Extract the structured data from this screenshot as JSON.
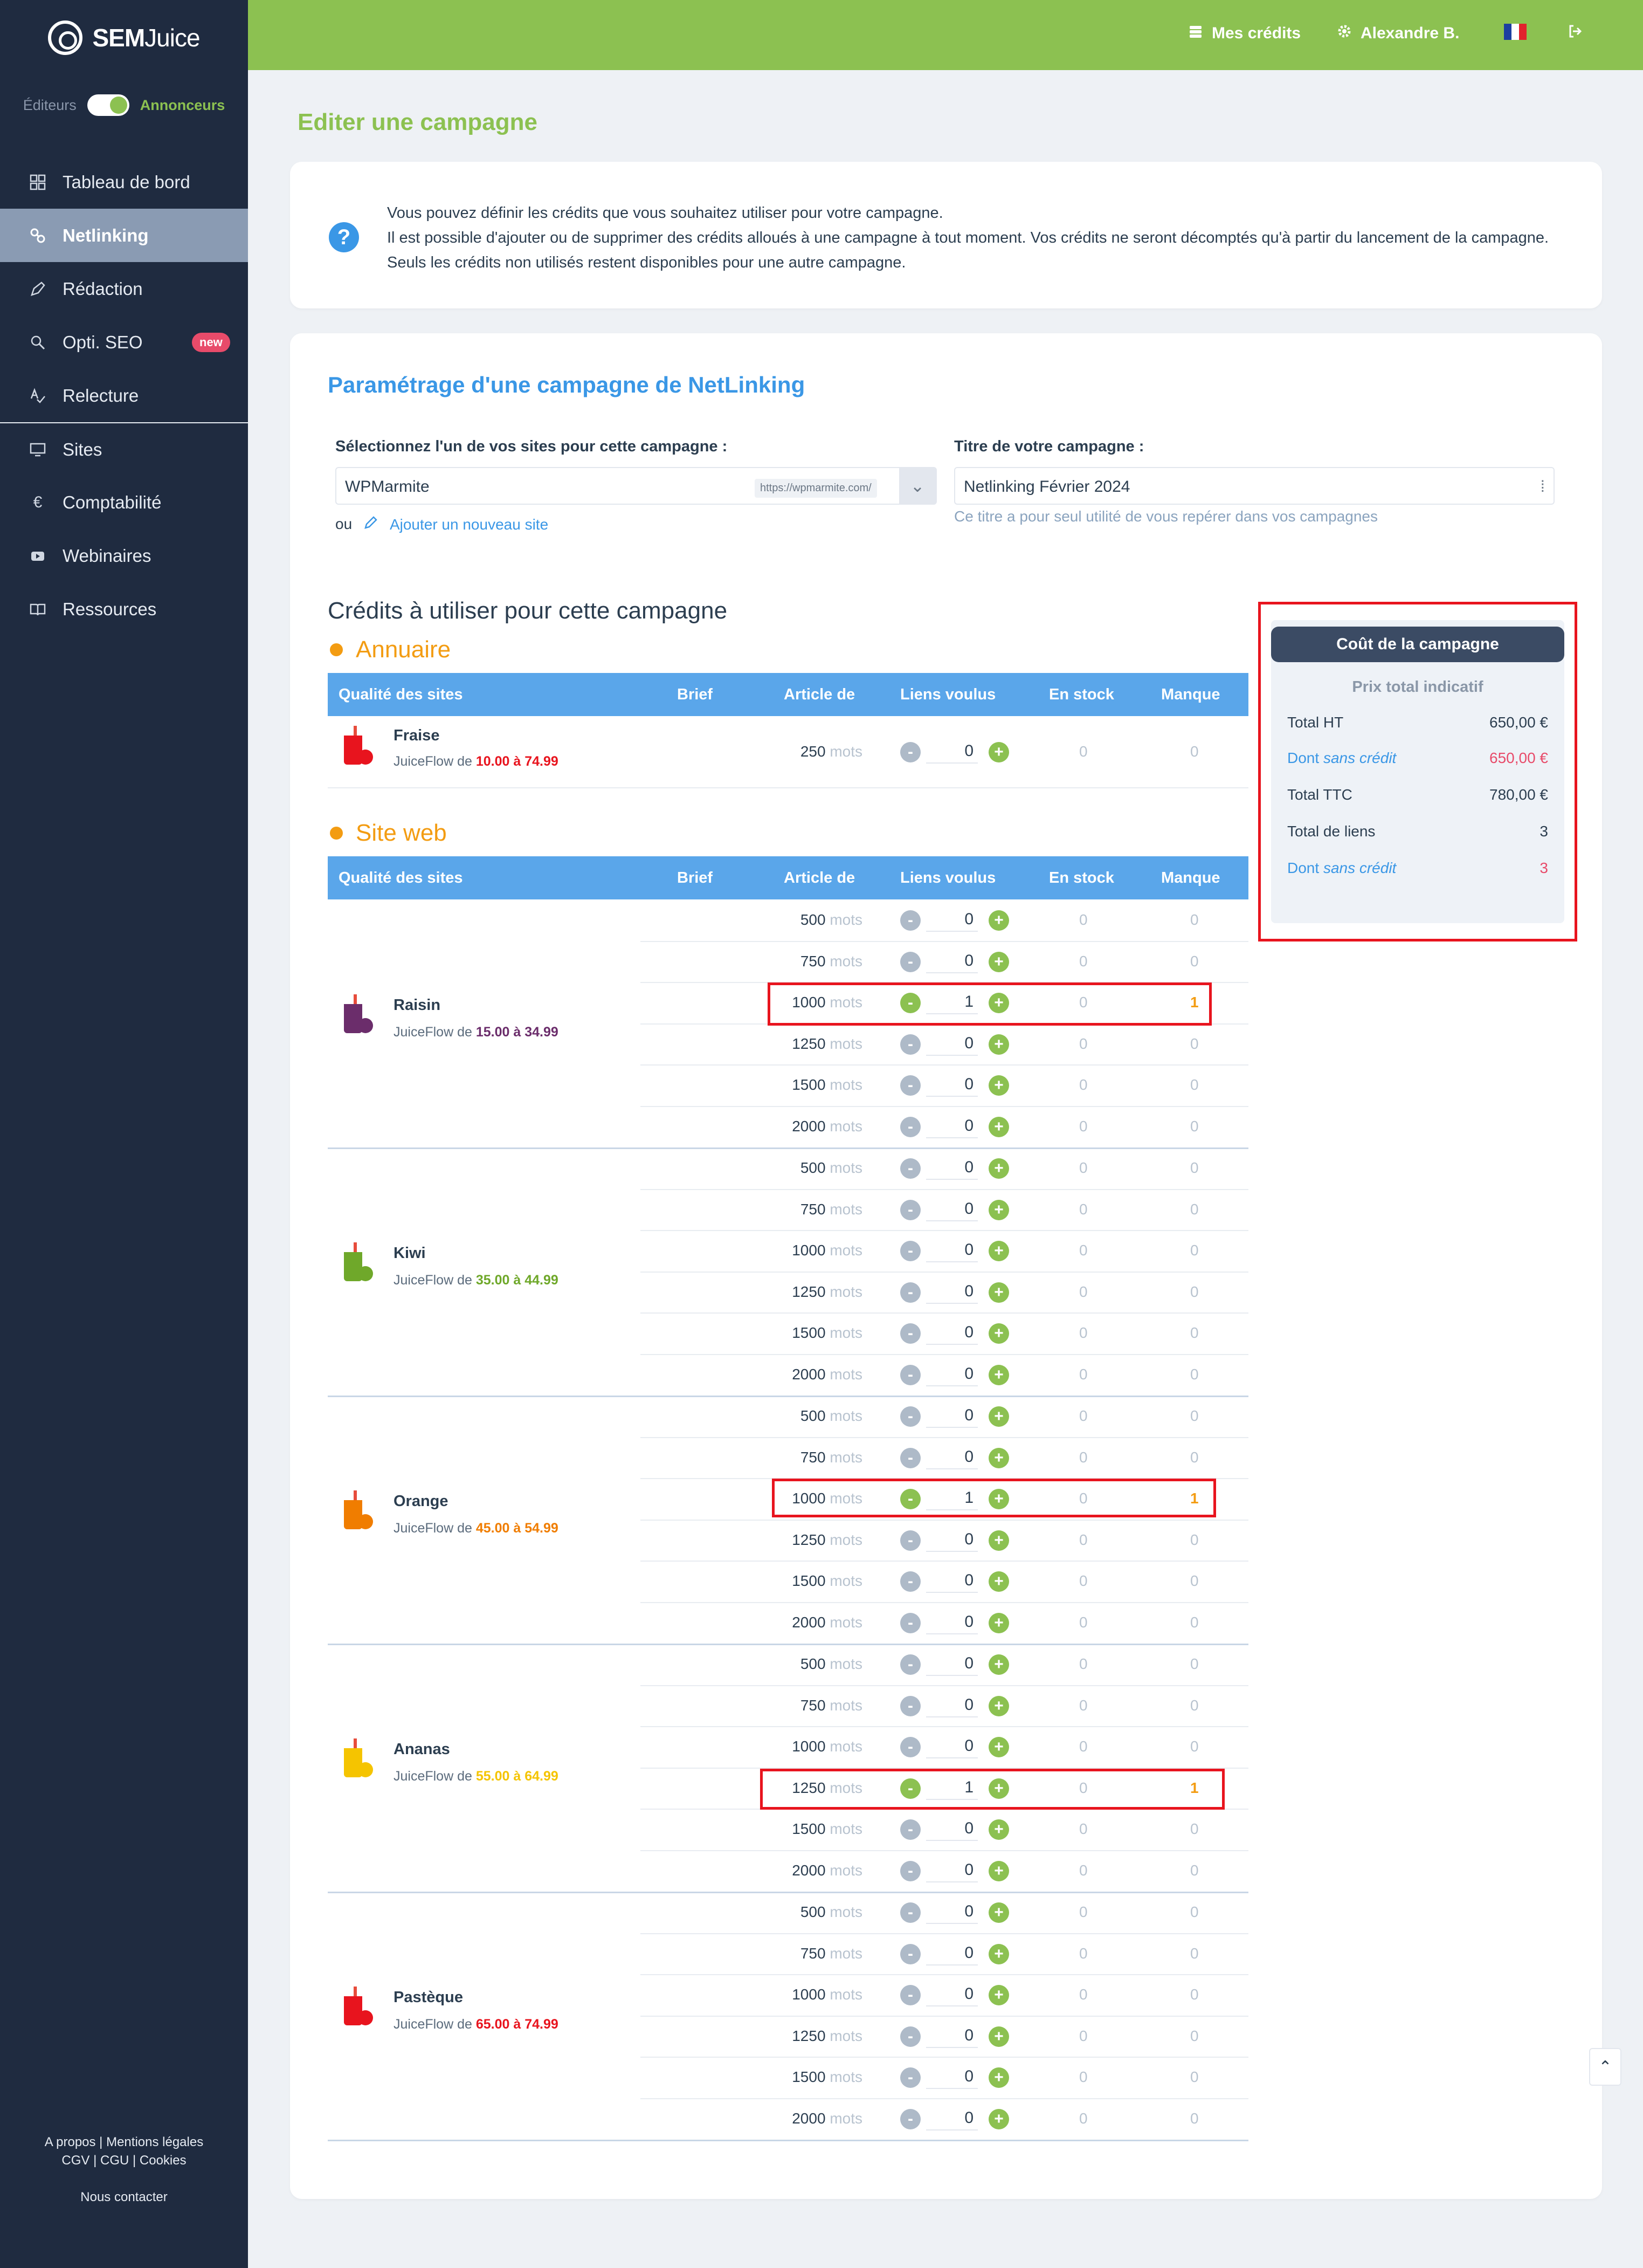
{
  "app": {
    "logo_bold": "SEM",
    "logo_light": "Juice",
    "switch_left": "Éditeurs",
    "switch_right": "Annonceurs"
  },
  "sidebar": {
    "items": [
      {
        "label": "Tableau de bord",
        "icon": "grid-icon"
      },
      {
        "label": "Netlinking",
        "icon": "link-icon"
      },
      {
        "label": "Rédaction",
        "icon": "pen-icon"
      },
      {
        "label": "Opti. SEO",
        "icon": "search-icon",
        "badge": "new"
      },
      {
        "label": "Relecture",
        "icon": "spellcheck-icon"
      },
      {
        "label": "Sites",
        "icon": "monitor-icon"
      },
      {
        "label": "Comptabilité",
        "icon": "euro-icon"
      },
      {
        "label": "Webinaires",
        "icon": "play-icon"
      },
      {
        "label": "Ressources",
        "icon": "book-icon"
      }
    ],
    "footer_line1": "A propos | Mentions légales",
    "footer_line2": "CGV | CGU | Cookies",
    "contact": "Nous contacter"
  },
  "topbar": {
    "credits": "Mes crédits",
    "user": "Alexandre B.",
    "language": "FR"
  },
  "page": {
    "title": "Editer une campagne",
    "help_line1": "Vous pouvez définir les crédits que vous souhaitez utiliser pour votre campagne.",
    "help_line2": "Il est possible d'ajouter ou de supprimer des crédits alloués à une campagne à tout moment. Vos crédits ne seront décomptés qu'à partir du lancement de la campagne. Seuls les crédits non utilisés restent disponibles pour une autre campagne."
  },
  "form": {
    "section_title": "Paramétrage d'une campagne de NetLinking",
    "site_label": "Sélectionnez l'un de vos sites pour cette campagne :",
    "site_value": "WPMarmite",
    "site_url": "https://wpmarmite.com/",
    "or": "ou",
    "add_site": "Ajouter un nouveau site",
    "title_label": "Titre de votre campagne :",
    "title_value": "Netlinking Février 2024",
    "title_hint": "Ce titre a pour seul utilité de vous repérer dans vos campagnes"
  },
  "credits": {
    "title": "Crédits à utiliser pour cette campagne",
    "columns": [
      "Qualité des sites",
      "Brief",
      "Article de",
      "Liens voulus",
      "En stock",
      "Manque"
    ],
    "unit": "mots",
    "annuaire_title": "Annuaire",
    "siteweb_title": "Site web",
    "annuaire": {
      "name": "Fraise",
      "price_prefix": "JuiceFlow de",
      "price_range": "10.00 à 74.99",
      "color": "#e8141e",
      "size": "250",
      "qty": "0",
      "stock": "0",
      "missing": "0"
    },
    "sites": [
      {
        "name": "Raisin",
        "price_prefix": "JuiceFlow de",
        "price_range": "15.00 à 34.99",
        "color": "#6b2d6b",
        "rows": [
          {
            "size": "500",
            "qty": "0",
            "stock": "0",
            "missing": "0"
          },
          {
            "size": "750",
            "qty": "0",
            "stock": "0",
            "missing": "0"
          },
          {
            "size": "1000",
            "qty": "1",
            "stock": "0",
            "missing": "1"
          },
          {
            "size": "1250",
            "qty": "0",
            "stock": "0",
            "missing": "0"
          },
          {
            "size": "1500",
            "qty": "0",
            "stock": "0",
            "missing": "0"
          },
          {
            "size": "2000",
            "qty": "0",
            "stock": "0",
            "missing": "0"
          }
        ]
      },
      {
        "name": "Kiwi",
        "price_prefix": "JuiceFlow de",
        "price_range": "35.00 à 44.99",
        "color": "#6fa82a",
        "rows": [
          {
            "size": "500",
            "qty": "0",
            "stock": "0",
            "missing": "0"
          },
          {
            "size": "750",
            "qty": "0",
            "stock": "0",
            "missing": "0"
          },
          {
            "size": "1000",
            "qty": "0",
            "stock": "0",
            "missing": "0"
          },
          {
            "size": "1250",
            "qty": "0",
            "stock": "0",
            "missing": "0"
          },
          {
            "size": "1500",
            "qty": "0",
            "stock": "0",
            "missing": "0"
          },
          {
            "size": "2000",
            "qty": "0",
            "stock": "0",
            "missing": "0"
          }
        ]
      },
      {
        "name": "Orange",
        "price_prefix": "JuiceFlow de",
        "price_range": "45.00 à 54.99",
        "color": "#f07d00",
        "rows": [
          {
            "size": "500",
            "qty": "0",
            "stock": "0",
            "missing": "0"
          },
          {
            "size": "750",
            "qty": "0",
            "stock": "0",
            "missing": "0"
          },
          {
            "size": "1000",
            "qty": "1",
            "stock": "0",
            "missing": "1"
          },
          {
            "size": "1250",
            "qty": "0",
            "stock": "0",
            "missing": "0"
          },
          {
            "size": "1500",
            "qty": "0",
            "stock": "0",
            "missing": "0"
          },
          {
            "size": "2000",
            "qty": "0",
            "stock": "0",
            "missing": "0"
          }
        ]
      },
      {
        "name": "Ananas",
        "price_prefix": "JuiceFlow de",
        "price_range": "55.00 à 64.99",
        "color": "#f5c400",
        "rows": [
          {
            "size": "500",
            "qty": "0",
            "stock": "0",
            "missing": "0"
          },
          {
            "size": "750",
            "qty": "0",
            "stock": "0",
            "missing": "0"
          },
          {
            "size": "1000",
            "qty": "0",
            "stock": "0",
            "missing": "0"
          },
          {
            "size": "1250",
            "qty": "1",
            "stock": "0",
            "missing": "1"
          },
          {
            "size": "1500",
            "qty": "0",
            "stock": "0",
            "missing": "0"
          },
          {
            "size": "2000",
            "qty": "0",
            "stock": "0",
            "missing": "0"
          }
        ]
      },
      {
        "name": "Pastèque",
        "price_prefix": "JuiceFlow de",
        "price_range": "65.00 à 74.99",
        "color": "#e8141e",
        "rows": [
          {
            "size": "500",
            "qty": "0",
            "stock": "0",
            "missing": "0"
          },
          {
            "size": "750",
            "qty": "0",
            "stock": "0",
            "missing": "0"
          },
          {
            "size": "1000",
            "qty": "0",
            "stock": "0",
            "missing": "0"
          },
          {
            "size": "1250",
            "qty": "0",
            "stock": "0",
            "missing": "0"
          },
          {
            "size": "1500",
            "qty": "0",
            "stock": "0",
            "missing": "0"
          },
          {
            "size": "2000",
            "qty": "0",
            "stock": "0",
            "missing": "0"
          }
        ]
      }
    ]
  },
  "cost": {
    "title": "Coût de la campagne",
    "subtitle": "Prix total indicatif",
    "total_ht_label": "Total HT",
    "total_ht": "650,00 €",
    "no_credit_label_prefix": "Dont",
    "no_credit_label_italic": "sans crédit",
    "no_credit_amount": "650,00 €",
    "total_ttc_label": "Total TTC",
    "total_ttc": "780,00 €",
    "total_links_label": "Total de liens",
    "total_links": "3",
    "no_credit_links": "3"
  },
  "colors": {
    "brand_green": "#8cc151",
    "sidebar_bg": "#1f2b40",
    "link_blue": "#3a97e6",
    "annuaire_orange": "#f39c12",
    "highlight_red": "#e8141e"
  }
}
